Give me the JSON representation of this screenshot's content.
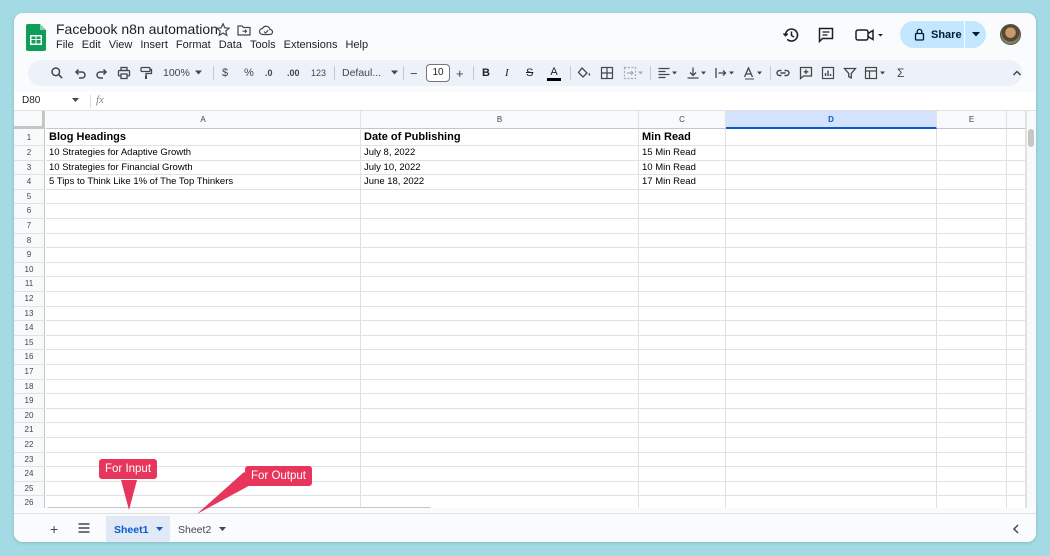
{
  "doc": {
    "title": "Facebook n8n automation"
  },
  "menu": [
    "File",
    "Edit",
    "View",
    "Insert",
    "Format",
    "Data",
    "Tools",
    "Extensions",
    "Help"
  ],
  "header": {
    "share_label": "Share"
  },
  "toolbar": {
    "zoom": "100%",
    "currency": "$",
    "percent": "%",
    "decimal_decrease": ".0",
    "decimal_increase": ".00",
    "number_format": "123",
    "font": "Defaul...",
    "font_size": "10",
    "font_size_minus": "−",
    "font_size_plus": "+",
    "bold": "B",
    "italic": "I",
    "strikethrough": "S",
    "text_color": "A",
    "functions": "Σ"
  },
  "formula_bar": {
    "name_box": "D80",
    "fx": "fx"
  },
  "columns": [
    "A",
    "B",
    "C",
    "D",
    "E"
  ],
  "selected_column": "D",
  "rows": [
    "1",
    "2",
    "3",
    "4",
    "5",
    "6",
    "7",
    "8",
    "9",
    "10",
    "11",
    "12",
    "13",
    "14",
    "15",
    "16",
    "17",
    "18",
    "19",
    "20",
    "21",
    "22",
    "23",
    "24",
    "25",
    "26"
  ],
  "cells": {
    "header": [
      "Blog Headings",
      "Date of Publishing",
      "Min Read"
    ],
    "data": [
      [
        "10 Strategies for Adaptive Growth",
        "July 8, 2022",
        "15 Min Read"
      ],
      [
        "10 Strategies for Financial Growth",
        "July 10, 2022",
        "10 Min Read"
      ],
      [
        "5 Tips to Think Like 1% of The Top Thinkers",
        "June 18, 2022",
        "17 Min Read"
      ]
    ]
  },
  "sheets": [
    "Sheet1",
    "Sheet2"
  ],
  "annotations": {
    "input": "For Input",
    "output": "For Output"
  },
  "colors": {
    "accent": "#0b57d0",
    "callout": "#e8355c",
    "share": "#c2e7ff",
    "background": "#a3dae3"
  }
}
